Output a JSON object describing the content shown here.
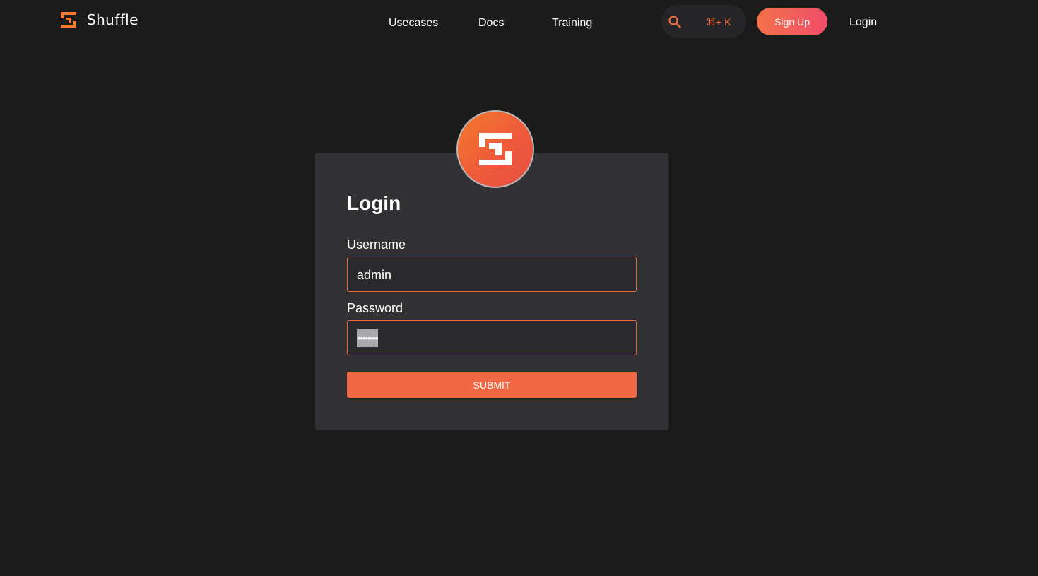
{
  "brand": {
    "name": "Shuffle",
    "logo_icon": "shuffle-logo-icon",
    "accent_color": "#f36844"
  },
  "nav": {
    "links": [
      {
        "label": "Usecases"
      },
      {
        "label": "Docs"
      },
      {
        "label": "Training"
      }
    ],
    "search": {
      "icon": "search-icon",
      "shortcut": "⌘+ K"
    },
    "signup_label": "Sign Up",
    "login_label": "Login"
  },
  "login_form": {
    "avatar_icon": "shuffle-logo-icon",
    "title": "Login",
    "username": {
      "label": "Username",
      "value": "admin"
    },
    "password": {
      "label": "Password",
      "value": "••••••••"
    },
    "submit_label": "SUBMIT"
  }
}
